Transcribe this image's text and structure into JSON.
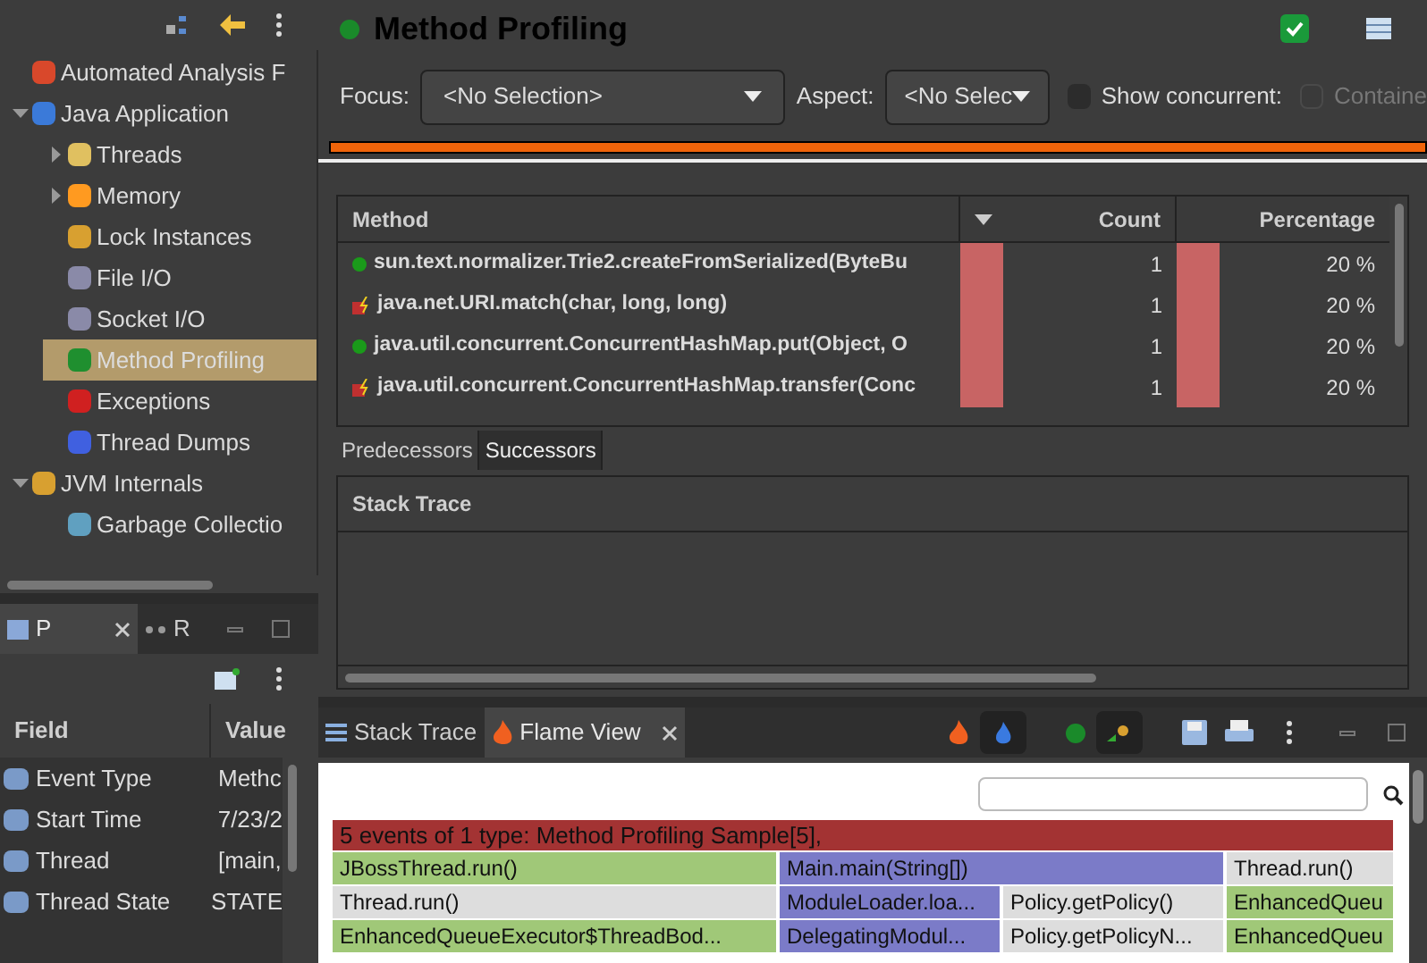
{
  "navigator": {
    "tree": [
      {
        "label": "Automated Analysis F",
        "selected": false
      },
      {
        "label": "Java Application",
        "selected": false,
        "expanded": true,
        "children": [
          {
            "label": "Threads",
            "selected": false,
            "expanded": false
          },
          {
            "label": "Memory",
            "selected": false,
            "expanded": false
          },
          {
            "label": "Lock Instances",
            "selected": false
          },
          {
            "label": "File I/O",
            "selected": false
          },
          {
            "label": "Socket I/O",
            "selected": false
          },
          {
            "label": "Method Profiling",
            "selected": true
          },
          {
            "label": "Exceptions",
            "selected": false
          },
          {
            "label": "Thread Dumps",
            "selected": false
          }
        ]
      },
      {
        "label": "JVM Internals",
        "selected": false,
        "expanded": true,
        "children": [
          {
            "label": "Garbage Collectio",
            "selected": false
          }
        ]
      }
    ]
  },
  "properties": {
    "tabs": [
      {
        "label": "P",
        "selected": true
      },
      {
        "label": "R",
        "selected": false
      }
    ],
    "columns": [
      "Field",
      "Value"
    ],
    "rows": [
      {
        "field": "Event Type",
        "value": "Methc"
      },
      {
        "field": "Start Time",
        "value": "7/23/2"
      },
      {
        "field": "Thread",
        "value": "[main,"
      },
      {
        "field": "Thread State",
        "value": "STATE"
      }
    ]
  },
  "page": {
    "title": "Method Profiling",
    "focus_label": "Focus:",
    "focus_value": "<No Selection>",
    "aspect_label": "Aspect:",
    "aspect_value": "<No Selec",
    "show_concurrent": {
      "label": "Show concurrent:",
      "checked": false
    },
    "contained": {
      "label": "Containe",
      "checked": false,
      "disabled": true
    },
    "table": {
      "columns": [
        "Method",
        "Count",
        "Percentage"
      ],
      "rows": [
        {
          "kind": "plain",
          "method": "sun.text.normalizer.Trie2.createFromSerialized(ByteBu",
          "count": "1",
          "percentage": "20 %"
        },
        {
          "kind": "flagged",
          "method": "java.net.URI.match(char, long, long)",
          "count": "1",
          "percentage": "20 %"
        },
        {
          "kind": "plain",
          "method": "java.util.concurrent.ConcurrentHashMap.put(Object, O",
          "count": "1",
          "percentage": "20 %"
        },
        {
          "kind": "flagged",
          "method": "java.util.concurrent.ConcurrentHashMap.transfer(Conc",
          "count": "1",
          "percentage": "20 %"
        }
      ]
    },
    "subtabs": [
      {
        "label": "Predecessors",
        "selected": true
      },
      {
        "label": "Successors",
        "selected": false
      }
    ],
    "stack_trace_column": "Stack Trace"
  },
  "bottom_view": {
    "tabs": [
      {
        "label": "Stack Trace",
        "selected": false
      },
      {
        "label": "Flame View",
        "selected": true
      }
    ],
    "flame": {
      "header": {
        "label": "5 events of 1 type: Method Profiling Sample[5],",
        "color": "#a33333"
      },
      "rows": [
        {
          "frames": [
            {
              "label": "JBossThread.run()",
              "color": "#a0c878",
              "wide": true
            },
            {
              "label": "Main.main(String[])",
              "color": "#7b7bc8",
              "wide": true
            },
            {
              "label": "Thread.run()",
              "color": "#dddddd",
              "wide": false
            }
          ]
        },
        {
          "frames": [
            {
              "label": "Thread.run()",
              "color": "#dddddd",
              "wide": true
            },
            {
              "label": "ModuleLoader.loa...",
              "color": "#7b7bc8",
              "wide": false
            },
            {
              "label": "Policy.getPolicy()",
              "color": "#dddddd",
              "wide": false
            },
            {
              "label": "EnhancedQueu",
              "color": "#a0c878",
              "wide": false
            }
          ]
        },
        {
          "frames": [
            {
              "label": "EnhancedQueueExecutor$ThreadBod...",
              "color": "#a0c878",
              "wide": true
            },
            {
              "label": "DelegatingModul...",
              "color": "#7b7bc8",
              "wide": false
            },
            {
              "label": "Policy.getPolicyN...",
              "color": "#dddddd",
              "wide": false
            },
            {
              "label": "EnhancedQueu",
              "color": "#a0c878",
              "wide": false
            }
          ]
        }
      ]
    }
  }
}
